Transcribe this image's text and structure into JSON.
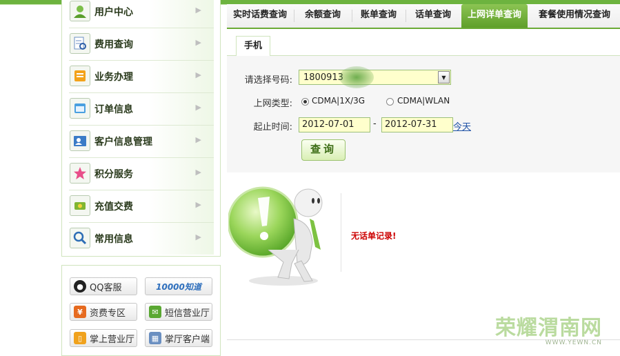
{
  "sidebar": {
    "items": [
      {
        "label": "用户中心",
        "icon": "user-icon"
      },
      {
        "label": "费用查询",
        "icon": "bill-search-icon"
      },
      {
        "label": "业务办理",
        "icon": "service-icon"
      },
      {
        "label": "订单信息",
        "icon": "order-icon"
      },
      {
        "label": "客户信息管理",
        "icon": "customer-icon"
      },
      {
        "label": "积分服务",
        "icon": "star-icon"
      },
      {
        "label": "充值交费",
        "icon": "recharge-icon"
      },
      {
        "label": "常用信息",
        "icon": "magnifier-icon"
      }
    ]
  },
  "tools": {
    "qq": "QQ客服",
    "zhidao_logo": "10000知道",
    "tariff": "资费专区",
    "sms_hall": "短信营业厅",
    "mobile_hall": "掌上营业厅",
    "client": "掌厅客户端"
  },
  "tabs": [
    {
      "label": "实时话费查询",
      "active": false
    },
    {
      "label": "余额查询",
      "active": false
    },
    {
      "label": "账单查询",
      "active": false
    },
    {
      "label": "话单查询",
      "active": false
    },
    {
      "label": "上网详单查询",
      "active": true
    },
    {
      "label": "套餐使用情况查询",
      "active": false
    }
  ],
  "subtab": "手机",
  "form": {
    "number_label": "请选择号码:",
    "number_value": "1800913",
    "type_label": "上网类型:",
    "type_options": [
      "CDMA|1X/3G",
      "CDMA|WLAN"
    ],
    "type_selected": 0,
    "range_label": "起止时间:",
    "start_date": "2012-07-01",
    "separator": "-",
    "end_date": "2012-07-31",
    "today_link": "今天",
    "query_button": "查询"
  },
  "result": {
    "message": "无话单记录!"
  },
  "watermark": {
    "title": "荣耀渭南网",
    "url": "WWW.YEWN.CN"
  },
  "colors": {
    "accent": "#6aaa35",
    "active_tab": "#6fb23a",
    "error": "#cc0000",
    "input_bg": "#ffffcc"
  }
}
